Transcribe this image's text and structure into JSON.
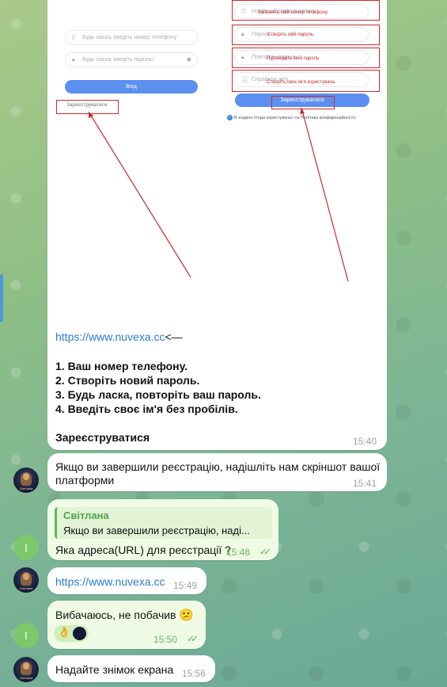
{
  "screenshot": {
    "login_phone_placeholder": "Будь ласка, введіть номер телефону",
    "login_password_placeholder": "Будь ласка, введіть пароль!",
    "login_button": "Вхід",
    "register_link": "Зареєструватися",
    "reg_account_placeholder": "Номер облікового запису",
    "reg_account_note": "Заповніть свій номер телефону.",
    "reg_password_placeholder": "Пароль",
    "reg_password_note": "Створіть свій пароль.",
    "reg_repeat_placeholder": "Повторіть пароль",
    "reg_repeat_note": "Підтвердіть свій пароль.",
    "reg_name_placeholder": "Справжнє ім'я",
    "reg_name_note": "Створіть своє ім'я користувача.",
    "reg_button": "Зареєструватися",
    "agree_text": "Я згоден«Угода користувача» та Політика конфіденційності»"
  },
  "messages": {
    "m1": {
      "url": "https://www.nuvexa.cc",
      "arrow": "<—",
      "steps": [
        "1. Ваш номер телефону.",
        "2. Створіть новий пароль.",
        "3. Будь ласка, повторіть ваш пароль.",
        "4. Введіть своє ім'я без пробілів."
      ],
      "footer": "Зареєструватися",
      "time": "15:40"
    },
    "m2": {
      "text1": "Якщо ви завершили реєстрацію, надішліть нам скріншот вашої",
      "text2": "платформи",
      "time": "15:41",
      "avatar_caption": "Світлана"
    },
    "m3": {
      "reply_author": "Світлана",
      "reply_text": "Якщо ви завершили реєстрацію, наді...",
      "text": "Яка адреса(URL) для реєстрації ?",
      "time": "15:48",
      "avatar_letter": "I"
    },
    "m4": {
      "url": "https://www.nuvexa.cc",
      "time": "15:49"
    },
    "m5": {
      "text": "Вибачаюсь, не побачив",
      "emoji": "😕",
      "reaction": "👌",
      "time": "15:50",
      "avatar_letter": "I"
    },
    "m6": {
      "text": "Надайте знімок екрана",
      "time": "15:56"
    }
  },
  "colors": {
    "link": "#2a7bd4",
    "reply_accent": "#5fb35c",
    "annotation_red": "#d12a2a"
  }
}
